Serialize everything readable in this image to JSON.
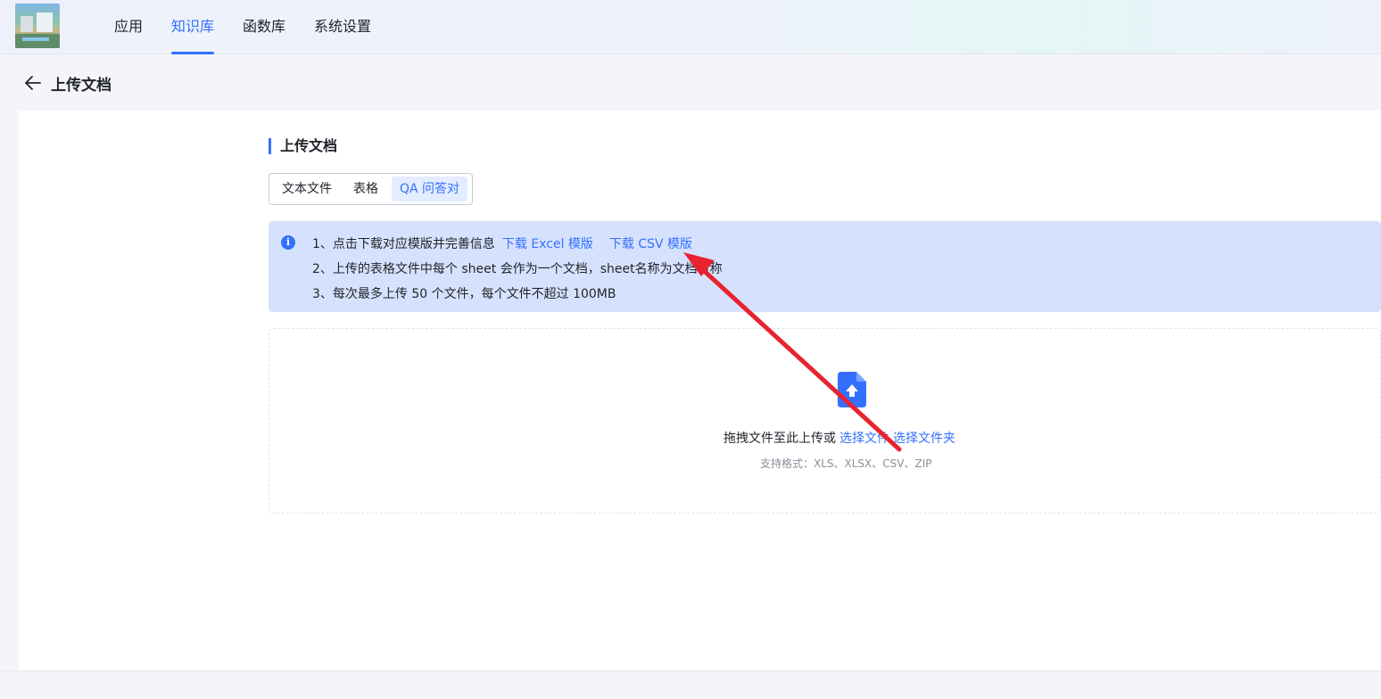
{
  "topbar": {
    "logo_icon": "app-logo-image",
    "nav": [
      {
        "label": "应用",
        "active": false
      },
      {
        "label": "知识库",
        "active": true
      },
      {
        "label": "函数库",
        "active": false
      },
      {
        "label": "系统设置",
        "active": false
      }
    ]
  },
  "page_header": {
    "back_icon": "arrow-left-icon",
    "title": "上传文档"
  },
  "section": {
    "title": "上传文档",
    "tabs": [
      {
        "label": "文本文件",
        "active": false
      },
      {
        "label": "表格",
        "active": false
      },
      {
        "label": "QA 问答对",
        "active": true
      }
    ]
  },
  "notice": {
    "icon": "info-icon",
    "line1": "1、点击下载对应模版并完善信息",
    "excel_link": "下载 Excel 模版",
    "csv_link": "下载 CSV 模版",
    "line2": "2、上传的表格文件中每个 sheet 会作为一个文档，sheet名称为文档名称",
    "line3": "3、每次最多上传 50 个文件，每个文件不超过 100MB"
  },
  "dropzone": {
    "icon": "file-upload-icon",
    "text": "拖拽文件至此上传或",
    "select_file": "选择文件",
    "select_folder": "选择文件夹",
    "formats": "支持格式：XLS、XLSX、CSV、ZIP"
  },
  "colors": {
    "accent": "#3370ff",
    "notice_bg": "#d6e2fd",
    "annotation_arrow": "#e8232f"
  }
}
